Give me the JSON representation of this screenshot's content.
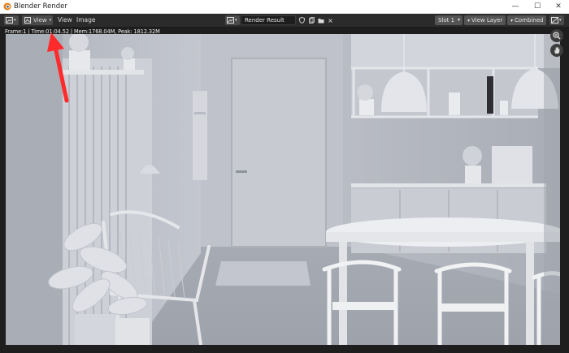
{
  "window": {
    "title": "Blender Render",
    "controls": {
      "minimize": "—",
      "maximize": "☐",
      "close": "✕"
    }
  },
  "toolbar": {
    "editor_type_icon": "image-editor-icon",
    "view_mode": "View",
    "menus": [
      "View",
      "Image"
    ],
    "image_name": "Render Result",
    "slot": "Slot 1",
    "view_layer": "View Layer",
    "pass": "Combined"
  },
  "stats": {
    "text": "Frame:1 | Time:01:04.52 | Mem:1768.04M, Peak: 1812.32M"
  },
  "nav": {
    "zoom_icon": "zoom-icon",
    "pan_icon": "hand-pan-icon"
  },
  "annotation": {
    "color": "#ff2b2b",
    "icon": "red-arrow"
  }
}
